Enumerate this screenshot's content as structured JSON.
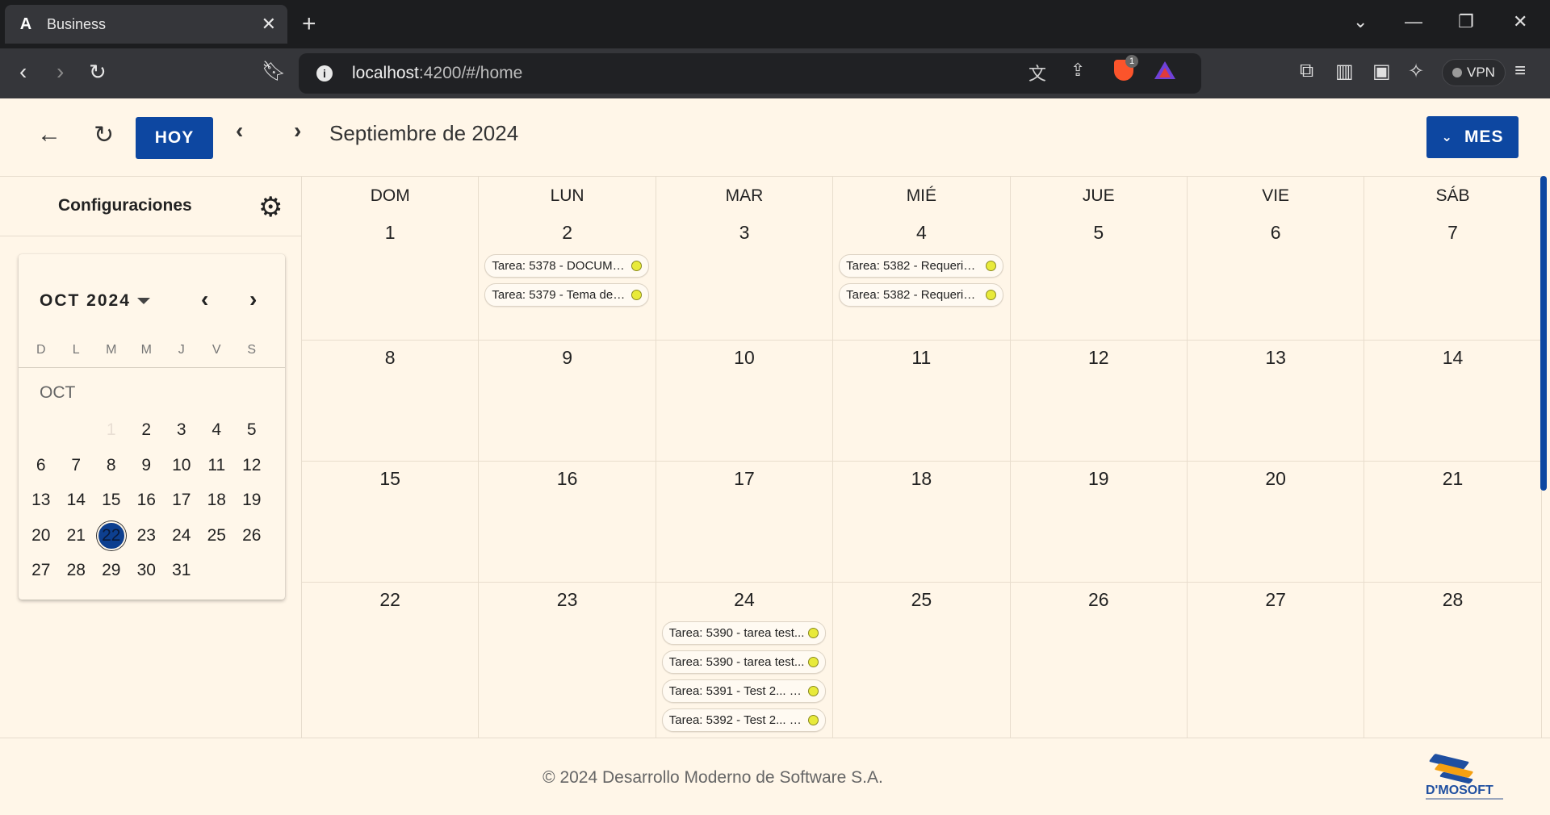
{
  "browser": {
    "tab_title": "Business",
    "tab_favicon": "A",
    "new_tab": "+",
    "url_host": "localhost",
    "url_path": ":4200/#/home",
    "brave_badge": "1",
    "vpn_label": "VPN"
  },
  "toolbar": {
    "today_label": "HOY",
    "month_title": "Septiembre de 2024",
    "view_label": "MES"
  },
  "sidebar": {
    "config_title": "Configuraciones",
    "minical": {
      "header": "OCT 2024",
      "month_label": "OCT",
      "dows": [
        "D",
        "L",
        "M",
        "M",
        "J",
        "V",
        "S"
      ],
      "today": 22
    }
  },
  "calendar": {
    "dows": [
      "DOM",
      "LUN",
      "MAR",
      "MIÉ",
      "JUE",
      "VIE",
      "SÁB"
    ],
    "weeks": [
      [
        1,
        2,
        3,
        4,
        5,
        6,
        7
      ],
      [
        8,
        9,
        10,
        11,
        12,
        13,
        14
      ],
      [
        15,
        16,
        17,
        18,
        19,
        20,
        21
      ],
      [
        22,
        23,
        24,
        25,
        26,
        27,
        28
      ]
    ],
    "events": {
      "2": [
        "Tarea: 5378 - DOCUME...",
        "Tarea: 5379 - Tema de l..."
      ],
      "4": [
        "Tarea: 5382 - Requerim...",
        "Tarea: 5382 - Requerim..."
      ],
      "24": [
        "Tarea: 5390 - tarea test...",
        "Tarea: 5390 - tarea test...",
        "Tarea: 5391 - Test 2... - ...",
        "Tarea: 5392 - Test 2... - ..."
      ]
    },
    "event_dot_color": "#e8ea3a"
  },
  "footer": {
    "copyright": "© 2024 Desarrollo Moderno de Software S.A.",
    "logo_text": "D'MOSOFT"
  },
  "colors": {
    "primary": "#0d47a1",
    "background": "#fff6e8"
  }
}
